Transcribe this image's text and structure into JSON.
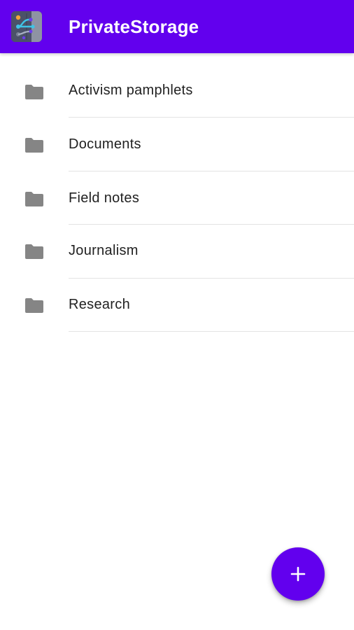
{
  "app_bar": {
    "title": "PrivateStorage",
    "logo_icon": "private-storage-logo-icon",
    "background_color": "#6200ee"
  },
  "folders": [
    {
      "label": "Activism pamphlets",
      "icon": "folder-icon"
    },
    {
      "label": "Documents",
      "icon": "folder-icon"
    },
    {
      "label": "Field notes",
      "icon": "folder-icon"
    },
    {
      "label": "Journalism",
      "icon": "folder-icon"
    },
    {
      "label": "Research",
      "icon": "folder-icon"
    }
  ],
  "fab": {
    "icon": "plus-icon",
    "color": "#6200ee"
  }
}
